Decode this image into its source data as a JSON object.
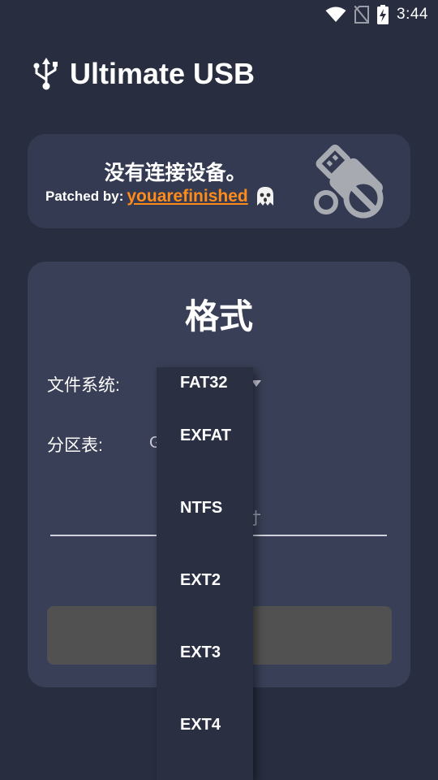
{
  "status_bar": {
    "time": "3:44"
  },
  "app": {
    "title": "Ultimate USB"
  },
  "status_card": {
    "message": "没有连接设备。",
    "patched_label": "Patched by:",
    "patched_author": "youarefinished"
  },
  "format_card": {
    "title": "格式",
    "filesystem_label": "文件系统:",
    "partition_label": "分区表:",
    "partition_value_partial": "G",
    "size_hint_partial": "寸"
  },
  "dropdown": {
    "options": [
      "FAT32",
      "EXFAT",
      "NTFS",
      "EXT2",
      "EXT3",
      "EXT4"
    ]
  },
  "colors": {
    "background": "#282d40",
    "card": "#343a51",
    "accent_link": "#ff8c1a",
    "button_disabled": "#515151"
  }
}
